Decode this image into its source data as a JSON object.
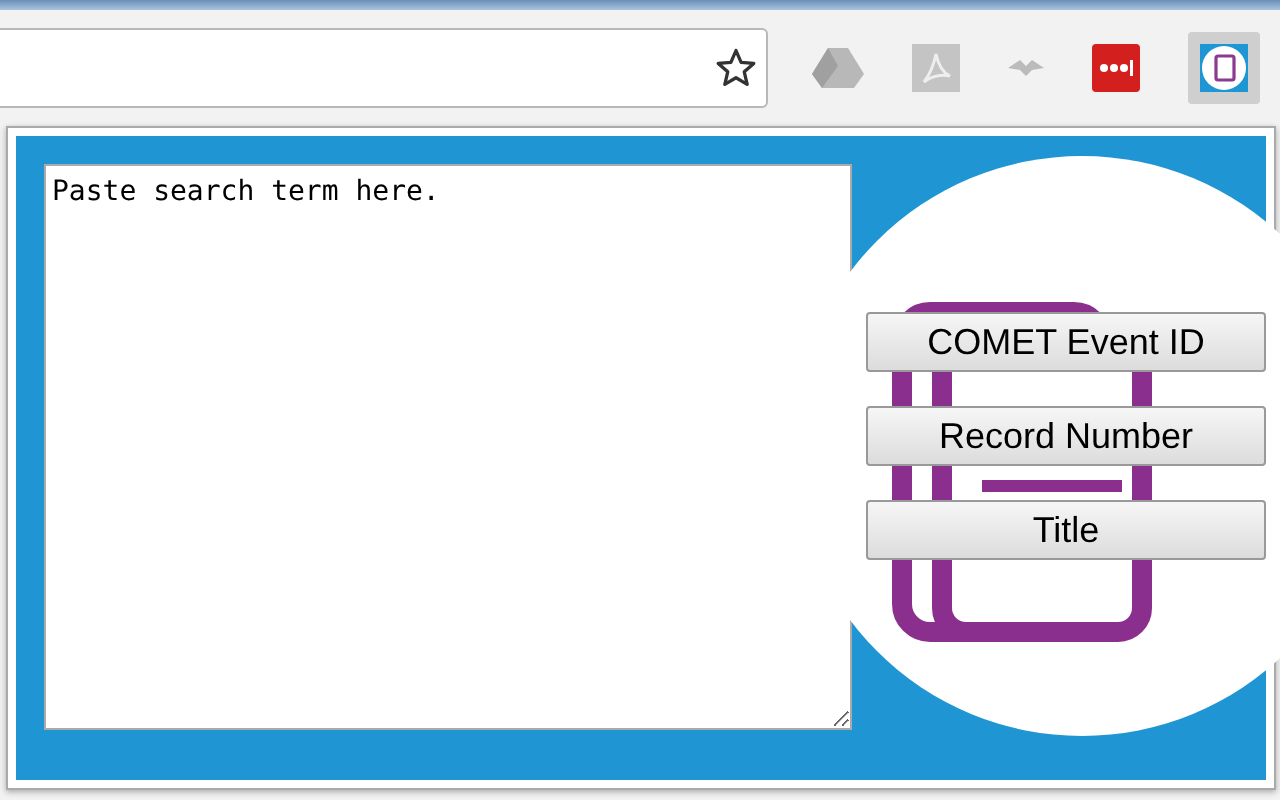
{
  "search": {
    "value": "Paste search term here."
  },
  "buttons": [
    {
      "label": "COMET Event ID"
    },
    {
      "label": "Record Number"
    },
    {
      "label": "Title"
    }
  ]
}
